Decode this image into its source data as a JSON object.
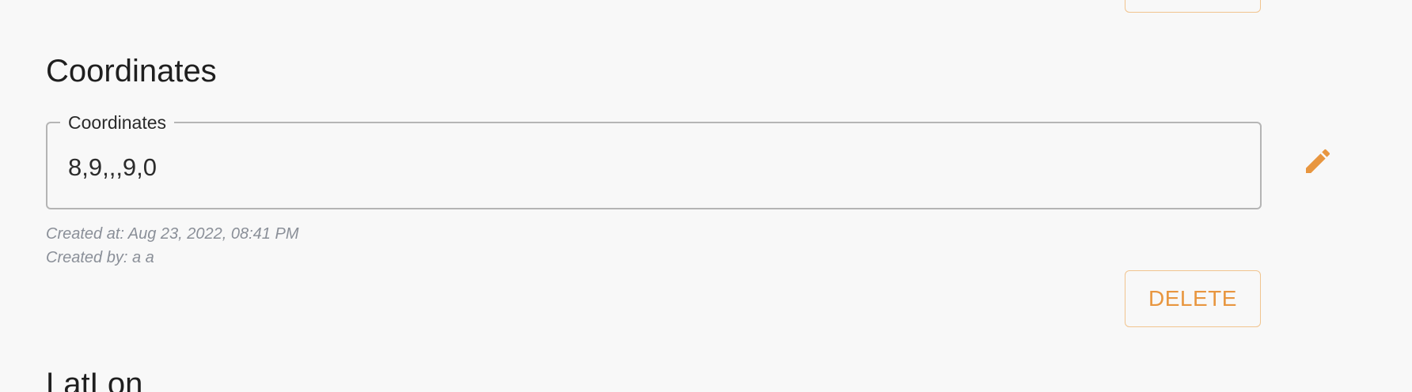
{
  "section": {
    "heading": "Coordinates"
  },
  "field": {
    "label": "Coordinates",
    "value": "8,9,,,9,0"
  },
  "meta": {
    "created_at": "Created at: Aug 23, 2022, 08:41 PM",
    "created_by": "Created by: a a"
  },
  "actions": {
    "delete_label": "DELETE",
    "edit_icon": "pencil-icon"
  },
  "next_section": {
    "heading": "LatLon"
  },
  "colors": {
    "accent": "#e8963f",
    "accent_border": "#f1c48f",
    "background": "#f8f8f8",
    "meta_text": "#8a8f98"
  }
}
